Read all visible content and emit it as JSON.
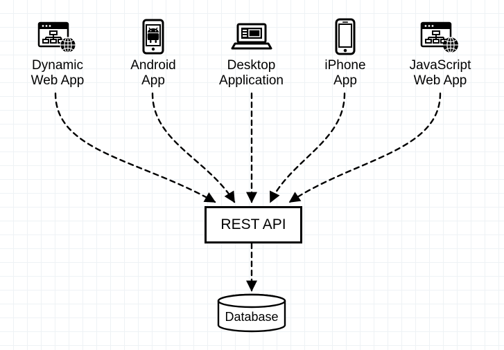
{
  "clients": [
    {
      "label_l1": "Dynamic",
      "label_l2": "Web App"
    },
    {
      "label_l1": "Android",
      "label_l2": "App"
    },
    {
      "label_l1": "Desktop",
      "label_l2": "Application"
    },
    {
      "label_l1": "iPhone",
      "label_l2": "App"
    },
    {
      "label_l1": "JavaScript",
      "label_l2": "Web App"
    }
  ],
  "rest_api": {
    "label": "REST API"
  },
  "database": {
    "label": "Database"
  }
}
